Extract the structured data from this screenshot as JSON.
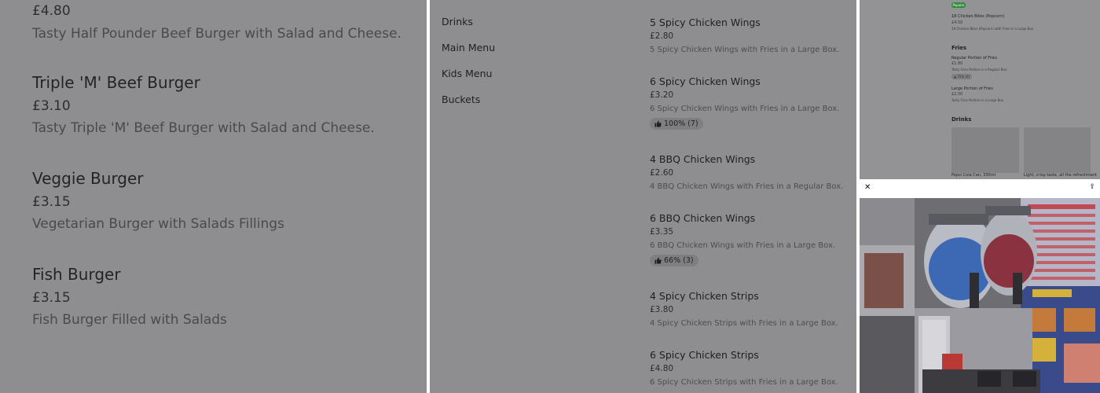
{
  "left_menu": {
    "items": [
      {
        "price": "£4.80",
        "desc": "Tasty Half Pounder Beef Burger with Salad and Cheese."
      },
      {
        "name": "Triple 'M' Beef Burger",
        "price": "£3.10",
        "desc": "Tasty Triple 'M' Beef Burger with Salad and Cheese."
      },
      {
        "name": "Veggie Burger",
        "price": "£3.15",
        "desc": "Vegetarian Burger with Salads Fillings"
      },
      {
        "name": "Fish Burger",
        "price": "£3.15",
        "desc": "Fish Burger Filled with Salads"
      }
    ]
  },
  "categories": [
    "Drinks",
    "Main Menu",
    "Kids Menu",
    "Buckets"
  ],
  "menu_items": [
    {
      "name": "5 Spicy Chicken Wings",
      "price": "£2.80",
      "desc": "5 Spicy Chicken Wings with Fries in a Large Box."
    },
    {
      "name": "6 Spicy Chicken Wings",
      "price": "£3.20",
      "desc": "6 Spicy Chicken Wings with Fries in a Large Box.",
      "rating": "100% (7)"
    },
    {
      "name": "4 BBQ Chicken Wings",
      "price": "£2.60",
      "desc": "4 BBQ Chicken Wings with Fries in a Regular Box."
    },
    {
      "name": "6 BBQ Chicken Wings",
      "price": "£3.35",
      "desc": "6 BBQ Chicken Wings with Fries in a Large Box.",
      "rating": "66% (3)"
    },
    {
      "name": "4 Spicy Chicken Strips",
      "price": "£3.80",
      "desc": "4 Spicy Chicken Strips with Fries in a Large Box."
    },
    {
      "name": "6 Spicy Chicken Strips",
      "price": "£4.80",
      "desc": "6 Spicy Chicken Strips with Fries in a Large Box."
    }
  ],
  "right_preview": {
    "popular_tag": "Popular",
    "popcorn_name": "18 Chicken Bites (Popcorn)",
    "popcorn_price": "£4.50",
    "popcorn_desc": "18 Chicken Bites (Popcorn) with Fries in a Large Box.",
    "fries_heading": "Fries",
    "regular_fries_name": "Regular Portion of Fries",
    "regular_fries_price": "£1.80",
    "regular_fries_desc": "Tasty Fries Portion in a Regular Box.",
    "regular_fries_rating": "75% (4)",
    "large_fries_name": "Large Portion of Fries",
    "large_fries_price": "£2.00",
    "large_fries_desc": "Tasty Fries Portion in a Large Box.",
    "drinks_heading": "Drinks",
    "drink1_name": "Pepsi Cola Can, 330ml",
    "drink2_name": "Light, crisp taste, all the refreshment",
    "close_glyph": "✕",
    "share_glyph": "⇪"
  }
}
